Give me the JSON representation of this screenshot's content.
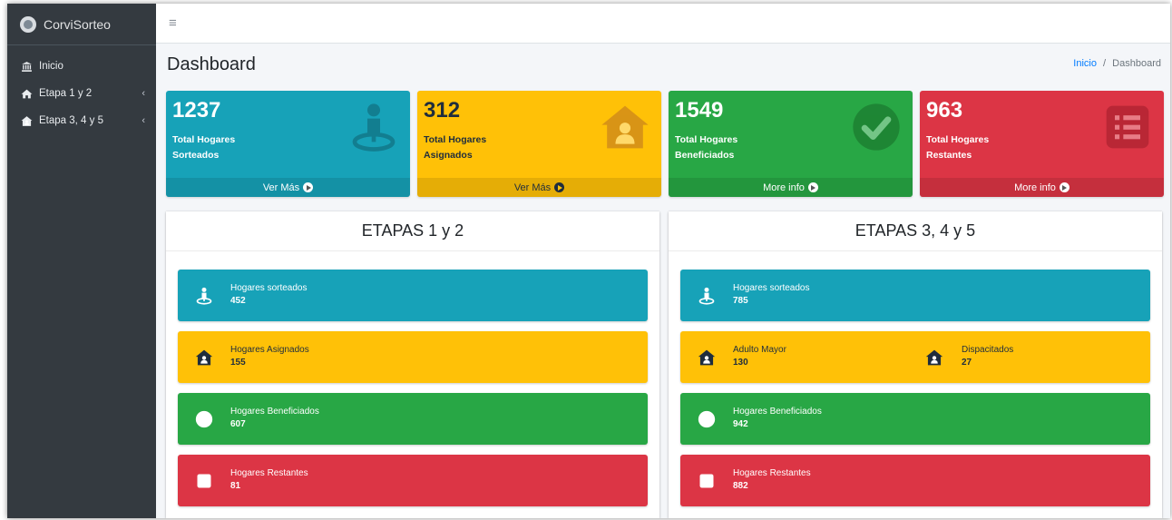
{
  "brand": {
    "name": "CorviSorteo"
  },
  "sidebar": {
    "items": [
      {
        "label": "Inicio",
        "icon": "bank-icon",
        "expandable": false
      },
      {
        "label": "Etapa 1 y 2",
        "icon": "home-icon",
        "expandable": true
      },
      {
        "label": "Etapa 3, 4 y 5",
        "icon": "house-user-icon",
        "expandable": true
      }
    ]
  },
  "topbar": {
    "menu_icon": "hamburger-icon"
  },
  "page": {
    "title": "Dashboard"
  },
  "breadcrumb": {
    "home": "Inicio",
    "separator": "/",
    "current": "Dashboard"
  },
  "stats": [
    {
      "value": "1237",
      "line1": "Total Hogares",
      "line2": "Sorteados",
      "footer": "Ver Más",
      "color": "#17a2b8",
      "icon": "person-pin-icon"
    },
    {
      "value": "312",
      "line1": "Total Hogares",
      "line2": "Asignados",
      "footer": "Ver Más",
      "color": "#ffc107",
      "icon": "house-user-icon"
    },
    {
      "value": "1549",
      "line1": "Total Hogares",
      "line2": "Beneficiados",
      "footer": "More info",
      "color": "#28a745",
      "icon": "check-circle-icon"
    },
    {
      "value": "963",
      "line1": "Total Hogares",
      "line2": "Restantes",
      "footer": "More info",
      "color": "#dc3545",
      "icon": "list-icon"
    }
  ],
  "panels": {
    "left": {
      "title": "ETAPAS 1 y 2",
      "boxes": [
        {
          "label": "Hogares sorteados",
          "value": "452"
        },
        {
          "label": "Hogares Asignados",
          "value": "155"
        },
        {
          "label": "Hogares Beneficiados",
          "value": "607"
        },
        {
          "label": "Hogares Restantes",
          "value": "81"
        }
      ]
    },
    "right": {
      "title": "ETAPAS 3, 4 y 5",
      "boxes": [
        {
          "label": "Hogares sorteados",
          "value": "785"
        },
        {
          "label": "Adulto Mayor",
          "value": "130",
          "label2": "Dispacitados",
          "value2": "27"
        },
        {
          "label": "Hogares Beneficiados",
          "value": "942"
        },
        {
          "label": "Hogares Restantes",
          "value": "882"
        }
      ]
    }
  }
}
